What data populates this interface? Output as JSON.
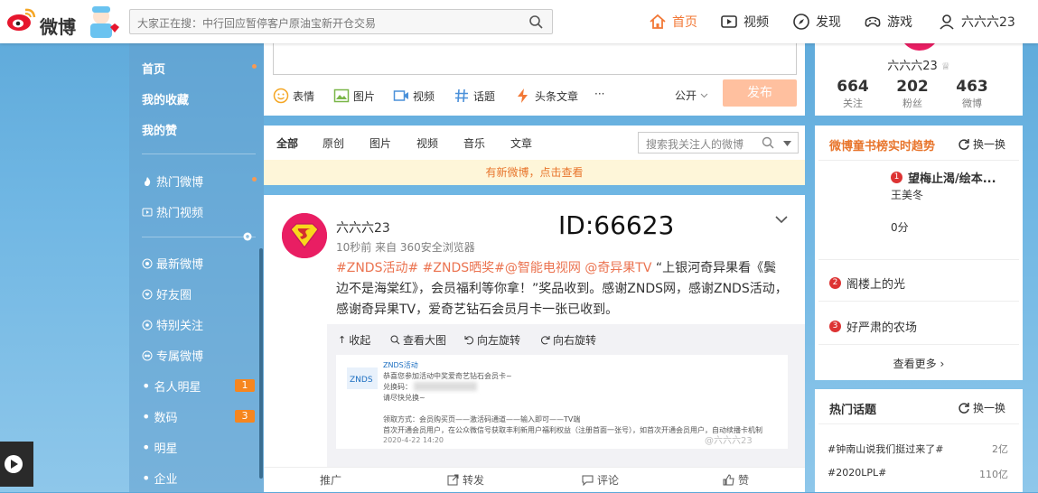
{
  "topbar": {
    "logo_text": "微博",
    "search_placeholder": "大家正在搜：中行回应暂停客户原油宝新开仓交易",
    "nav": {
      "home": "首页",
      "video": "视频",
      "discover": "发现",
      "game": "游戏",
      "user": "六六六23"
    }
  },
  "left_nav": {
    "home": "首页",
    "favorites": "我的收藏",
    "likes": "我的赞",
    "hot_weibo": "热门微博",
    "hot_video": "热门视频",
    "latest": "最新微博",
    "friends": "好友圈",
    "special": "特别关注",
    "exclusive": "专属微博",
    "celebrity": "名人明星",
    "celebrity_badge": "1",
    "digital": "数码",
    "digital_badge": "3",
    "star": "明星",
    "enterprise": "企业"
  },
  "composer": {
    "emoji": "表情",
    "image": "图片",
    "video": "视频",
    "topic": "话题",
    "article": "头条文章",
    "more": "···",
    "visibility": "公开",
    "publish": "发布"
  },
  "feed_tabs": {
    "all": "全部",
    "original": "原创",
    "images": "图片",
    "video": "视频",
    "music": "音乐",
    "articles": "文章",
    "search_placeholder": "搜索我关注人的微博",
    "new_notice": "有新微博，点击查看"
  },
  "post": {
    "username": "六六六23",
    "id_overlay": "ID:66623",
    "meta": "10秒前 来自 360安全浏览器",
    "tag1": "#ZNDS活动#",
    "tag2": "#ZNDS晒奖#",
    "mention1": "@智能电视网",
    "mention2": "@奇异果TV",
    "body": "“上银河奇异果看《鬓边不是海棠红》，会员福利等你拿！”奖品收到。感谢ZNDS网，感谢ZNDS活动，感谢奇异果TV，爱奇艺钻石会员月卡一张已收到。",
    "media_tools": {
      "collapse": "收起",
      "view_large": "查看大图",
      "rotate_left": "向左旋转",
      "rotate_right": "向右旋转"
    },
    "image": {
      "line1": "ZNDS活动",
      "line2": "恭喜您参加活动中奖爱奇艺钻石会员卡~",
      "line3": "兑换码：",
      "line4": "请尽快兑换~",
      "line5": "领取方式：会员购买页——激活码通道——输入即可——TV端",
      "line6": "首次开通会员用户，在公众微信号获取丰利新用户福利权益（注册首面一张号），如首次开通会员用户，自动续播卡机制权益",
      "date": "2020-4-22 14:20",
      "watermark": "@六六六23"
    },
    "actions": {
      "promote": "推广",
      "repost": "转发",
      "comment": "评论",
      "like": "赞"
    }
  },
  "profile": {
    "name": "六六六23",
    "following": "664",
    "following_label": "关注",
    "followers": "202",
    "followers_label": "粉丝",
    "posts": "463",
    "posts_label": "微博"
  },
  "trend": {
    "title": "微博童书榜实时趋势",
    "refresh": "换一换",
    "items": [
      {
        "rank": "1",
        "title": "望梅止渴/绘本...",
        "author": "王美冬",
        "score": "0分"
      },
      {
        "rank": "2",
        "title": "阁楼上的光"
      },
      {
        "rank": "3",
        "title": "好严肃的农场"
      }
    ],
    "more": "查看更多"
  },
  "topics": {
    "title": "热门话题",
    "refresh": "换一换",
    "items": [
      {
        "name": "#钟南山说我们挺过来了#",
        "count": "2亿"
      },
      {
        "name": "#2020LPL#",
        "count": "110亿"
      }
    ]
  },
  "colors": {
    "accent": "#f27836",
    "topic": "#eb7350",
    "rank": "#d33333"
  }
}
